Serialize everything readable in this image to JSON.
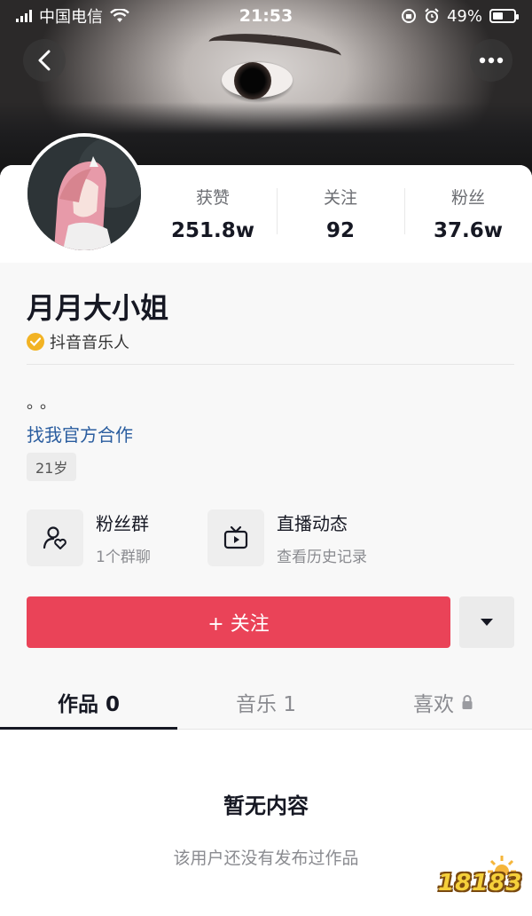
{
  "status_bar": {
    "carrier": "中国电信",
    "time": "21:53",
    "battery": "49%",
    "battery_level": 0.49
  },
  "nav": {
    "back_icon": "back-chevron-icon",
    "more_icon": "more-dots-icon"
  },
  "profile": {
    "name": "月月大小姐",
    "verified_label": "抖音音乐人",
    "bio": "。。",
    "bio_link": "找我官方合作",
    "age_tag": "21岁"
  },
  "stats": [
    {
      "label": "获赞",
      "value": "251.8w"
    },
    {
      "label": "关注",
      "value": "92"
    },
    {
      "label": "粉丝",
      "value": "37.6w"
    }
  ],
  "features": [
    {
      "title": "粉丝群",
      "subtitle": "1个群聊",
      "icon": "fan-group-icon"
    },
    {
      "title": "直播动态",
      "subtitle": "查看历史记录",
      "icon": "live-tv-icon"
    }
  ],
  "actions": {
    "follow_label": "+ 关注",
    "dropdown_icon": "caret-down-icon"
  },
  "tabs": [
    {
      "label": "作品 0",
      "active": true
    },
    {
      "label": "音乐 1",
      "active": false
    },
    {
      "label": "喜欢",
      "active": false,
      "locked": true
    }
  ],
  "empty_state": {
    "title": "暂无内容",
    "subtitle": "该用户还没有发布过作品"
  },
  "watermark": {
    "text": "18183"
  },
  "colors": {
    "accent": "#ea4358",
    "link": "#2a5d9f",
    "badge": "#f2b324"
  }
}
